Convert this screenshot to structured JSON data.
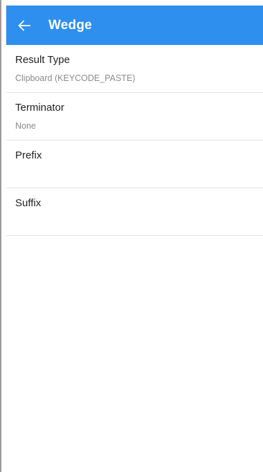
{
  "app_bar": {
    "title": "Wedge",
    "back_icon": "arrow-left-icon",
    "color": "#2f8fef"
  },
  "preferences": [
    {
      "title": "Result Type",
      "summary": "Clipboard (KEYCODE_PASTE)"
    },
    {
      "title": "Terminator",
      "summary": "None"
    },
    {
      "title": "Prefix",
      "summary": ""
    },
    {
      "title": "Suffix",
      "summary": ""
    }
  ]
}
